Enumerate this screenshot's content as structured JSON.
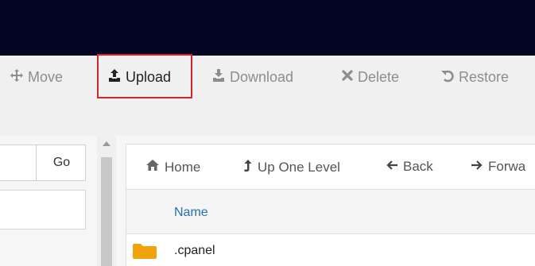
{
  "toolbar": {
    "move_label": "Move",
    "upload_label": "Upload",
    "download_label": "Download",
    "delete_label": "Delete",
    "restore_label": "Restore",
    "highlight_color": "#d6242f"
  },
  "path_bar": {
    "go_label": "Go"
  },
  "nav": {
    "home_label": "Home",
    "up_label": "Up One Level",
    "back_label": "Back",
    "forward_label": "Forwa"
  },
  "table": {
    "columns": [
      "Name"
    ],
    "rows": [
      {
        "name": ".cpanel",
        "icon": "folder-icon"
      }
    ]
  },
  "colors": {
    "header_bg": "#040522",
    "toolbar_bg": "#f0f0f0",
    "folder": "#f0a30a",
    "column_link": "#2a6fb0"
  }
}
